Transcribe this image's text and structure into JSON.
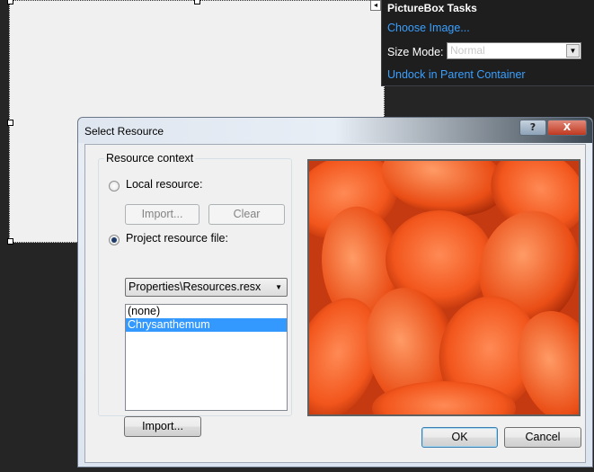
{
  "tasks_panel": {
    "title": "PictureBox Tasks",
    "choose_image": "Choose Image...",
    "size_mode_label": "Size Mode:",
    "size_mode_value": "Normal",
    "undock": "Undock in Parent Container"
  },
  "dialog": {
    "title": "Select Resource",
    "help": "?",
    "close": "X",
    "group_label": "Resource context",
    "local_resource": "Local resource:",
    "local_import": "Import...",
    "local_clear": "Clear",
    "project_resource_file": "Project resource file:",
    "resource_file_value": "Properties\\Resources.resx",
    "resources": [
      {
        "label": "(none)",
        "selected": false
      },
      {
        "label": "Chrysanthemum",
        "selected": true
      }
    ],
    "project_import": "Import...",
    "ok": "OK",
    "cancel": "Cancel",
    "selected_radio": "project"
  },
  "colors": {
    "link": "#3aa0ff",
    "selection": "#3399ff",
    "preview_base": "#e2481a"
  }
}
